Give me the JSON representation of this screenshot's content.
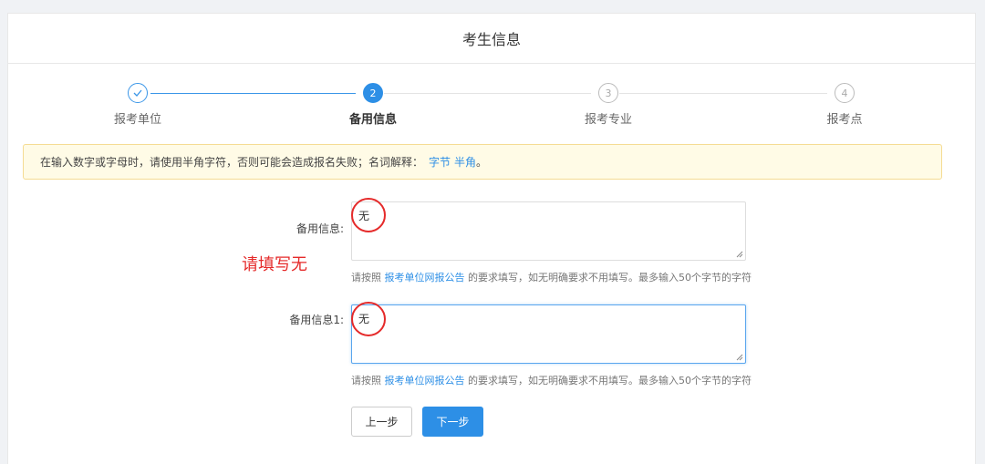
{
  "header": {
    "title": "考生信息"
  },
  "steps": [
    {
      "index": "1",
      "label": "报考单位",
      "state": "done"
    },
    {
      "index": "2",
      "label": "备用信息",
      "state": "active"
    },
    {
      "index": "3",
      "label": "报考专业",
      "state": "todo"
    },
    {
      "index": "4",
      "label": "报考点",
      "state": "todo"
    }
  ],
  "alert": {
    "text": "在输入数字或字母时，请使用半角字符，否则可能会造成报名失败；名词解释：",
    "link1": "字节",
    "link2": "半角",
    "suffix": "。"
  },
  "form": {
    "field1": {
      "label": "备用信息:",
      "value": "无",
      "hint_prefix": "请按照",
      "hint_link": "报考单位网报公告",
      "hint_suffix": "的要求填写，如无明确要求不用填写。最多输入50个字节的字符"
    },
    "field2": {
      "label": "备用信息1:",
      "value": "无",
      "hint_prefix": "请按照",
      "hint_link": "报考单位网报公告",
      "hint_suffix": "的要求填写，如无明确要求不用填写。最多输入50个字节的字符"
    }
  },
  "annotation": {
    "text": "请填写无",
    "color": "#e52a2a"
  },
  "buttons": {
    "prev": "上一步",
    "next": "下一步"
  },
  "colors": {
    "accent": "#2d8fe6",
    "alert_bg": "#fffbe6",
    "annotation": "#e52a2a"
  }
}
